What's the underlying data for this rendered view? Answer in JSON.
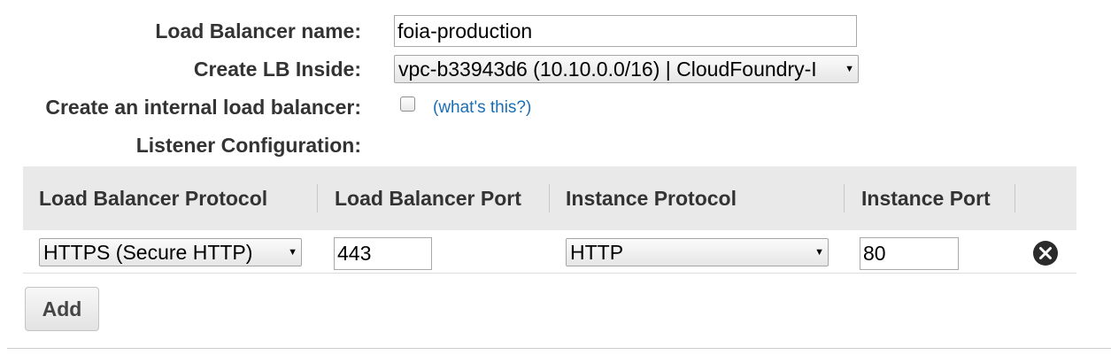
{
  "form": {
    "lb_name_label": "Load Balancer name:",
    "lb_name_value": "foia-production",
    "create_inside_label": "Create LB Inside:",
    "create_inside_value": "vpc-b33943d6 (10.10.0.0/16) | CloudFoundry-I",
    "internal_label": "Create an internal load balancer:",
    "internal_checked": false,
    "whats_this_link": "(what's this?)",
    "listener_label": "Listener Configuration:"
  },
  "listener_table": {
    "headers": [
      "Load Balancer Protocol",
      "Load Balancer Port",
      "Instance Protocol",
      "Instance Port"
    ],
    "rows": [
      {
        "lb_protocol": "HTTPS (Secure HTTP)",
        "lb_port": "443",
        "instance_protocol": "HTTP",
        "instance_port": "80",
        "remove_icon": "remove-circle-icon"
      }
    ]
  },
  "actions": {
    "add_label": "Add"
  },
  "colors": {
    "link": "#1a6eb5",
    "header_bg": "#e9e9e9",
    "label_text": "#333333"
  }
}
